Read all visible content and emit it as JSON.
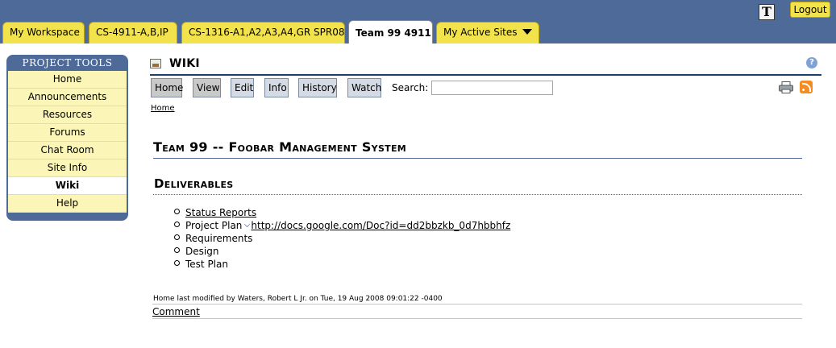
{
  "site_tabs": [
    {
      "label": "My Workspace"
    },
    {
      "label": "CS-4911-A,B,IP"
    },
    {
      "label": "CS-1316-A1,A2,A3,A4,GR SPR08"
    },
    {
      "label": "Team 99 4911"
    },
    {
      "label": "My Active Sites"
    }
  ],
  "header": {
    "text_size_glyph": "T",
    "logout_label": "Logout"
  },
  "tools": {
    "title": "PROJECT TOOLS",
    "items": [
      {
        "label": "Home"
      },
      {
        "label": "Announcements"
      },
      {
        "label": "Resources"
      },
      {
        "label": "Forums"
      },
      {
        "label": "Chat Room"
      },
      {
        "label": "Site Info"
      },
      {
        "label": "Wiki"
      },
      {
        "label": "Help"
      }
    ],
    "selected": "Wiki"
  },
  "wiki": {
    "title": "WIKI",
    "help_glyph": "?",
    "toolbar": {
      "home": "Home",
      "view": "View",
      "edit": "Edit",
      "info": "Info",
      "history": "History",
      "watch": "Watch",
      "search_label": "Search:",
      "search_value": ""
    },
    "breadcrumb": "Home",
    "heading": "Team 99 -- Foobar Management System",
    "subheading": "Deliverables",
    "deliverables": [
      {
        "label": "Status Reports"
      },
      {
        "label": "Project Plan",
        "url": "http://docs.google.com/Doc?id=dd2bbzkb_0d7hbbhfz"
      },
      {
        "label": "Requirements"
      },
      {
        "label": "Design"
      },
      {
        "label": "Test Plan"
      }
    ],
    "modified": "Home last modified by Waters, Robert L Jr. on Tue, 19 Aug 2008 09:01:22 -0400",
    "comment": "Comment"
  },
  "colors": {
    "banner": "#4d6a99",
    "tab": "#f2e34c",
    "tool_item": "#fbf6b8"
  },
  "icons": [
    "text-size-icon",
    "wiki-icon",
    "help-icon",
    "print-icon",
    "rss-icon",
    "external-link-icon",
    "dropdown-caret-icon"
  ]
}
